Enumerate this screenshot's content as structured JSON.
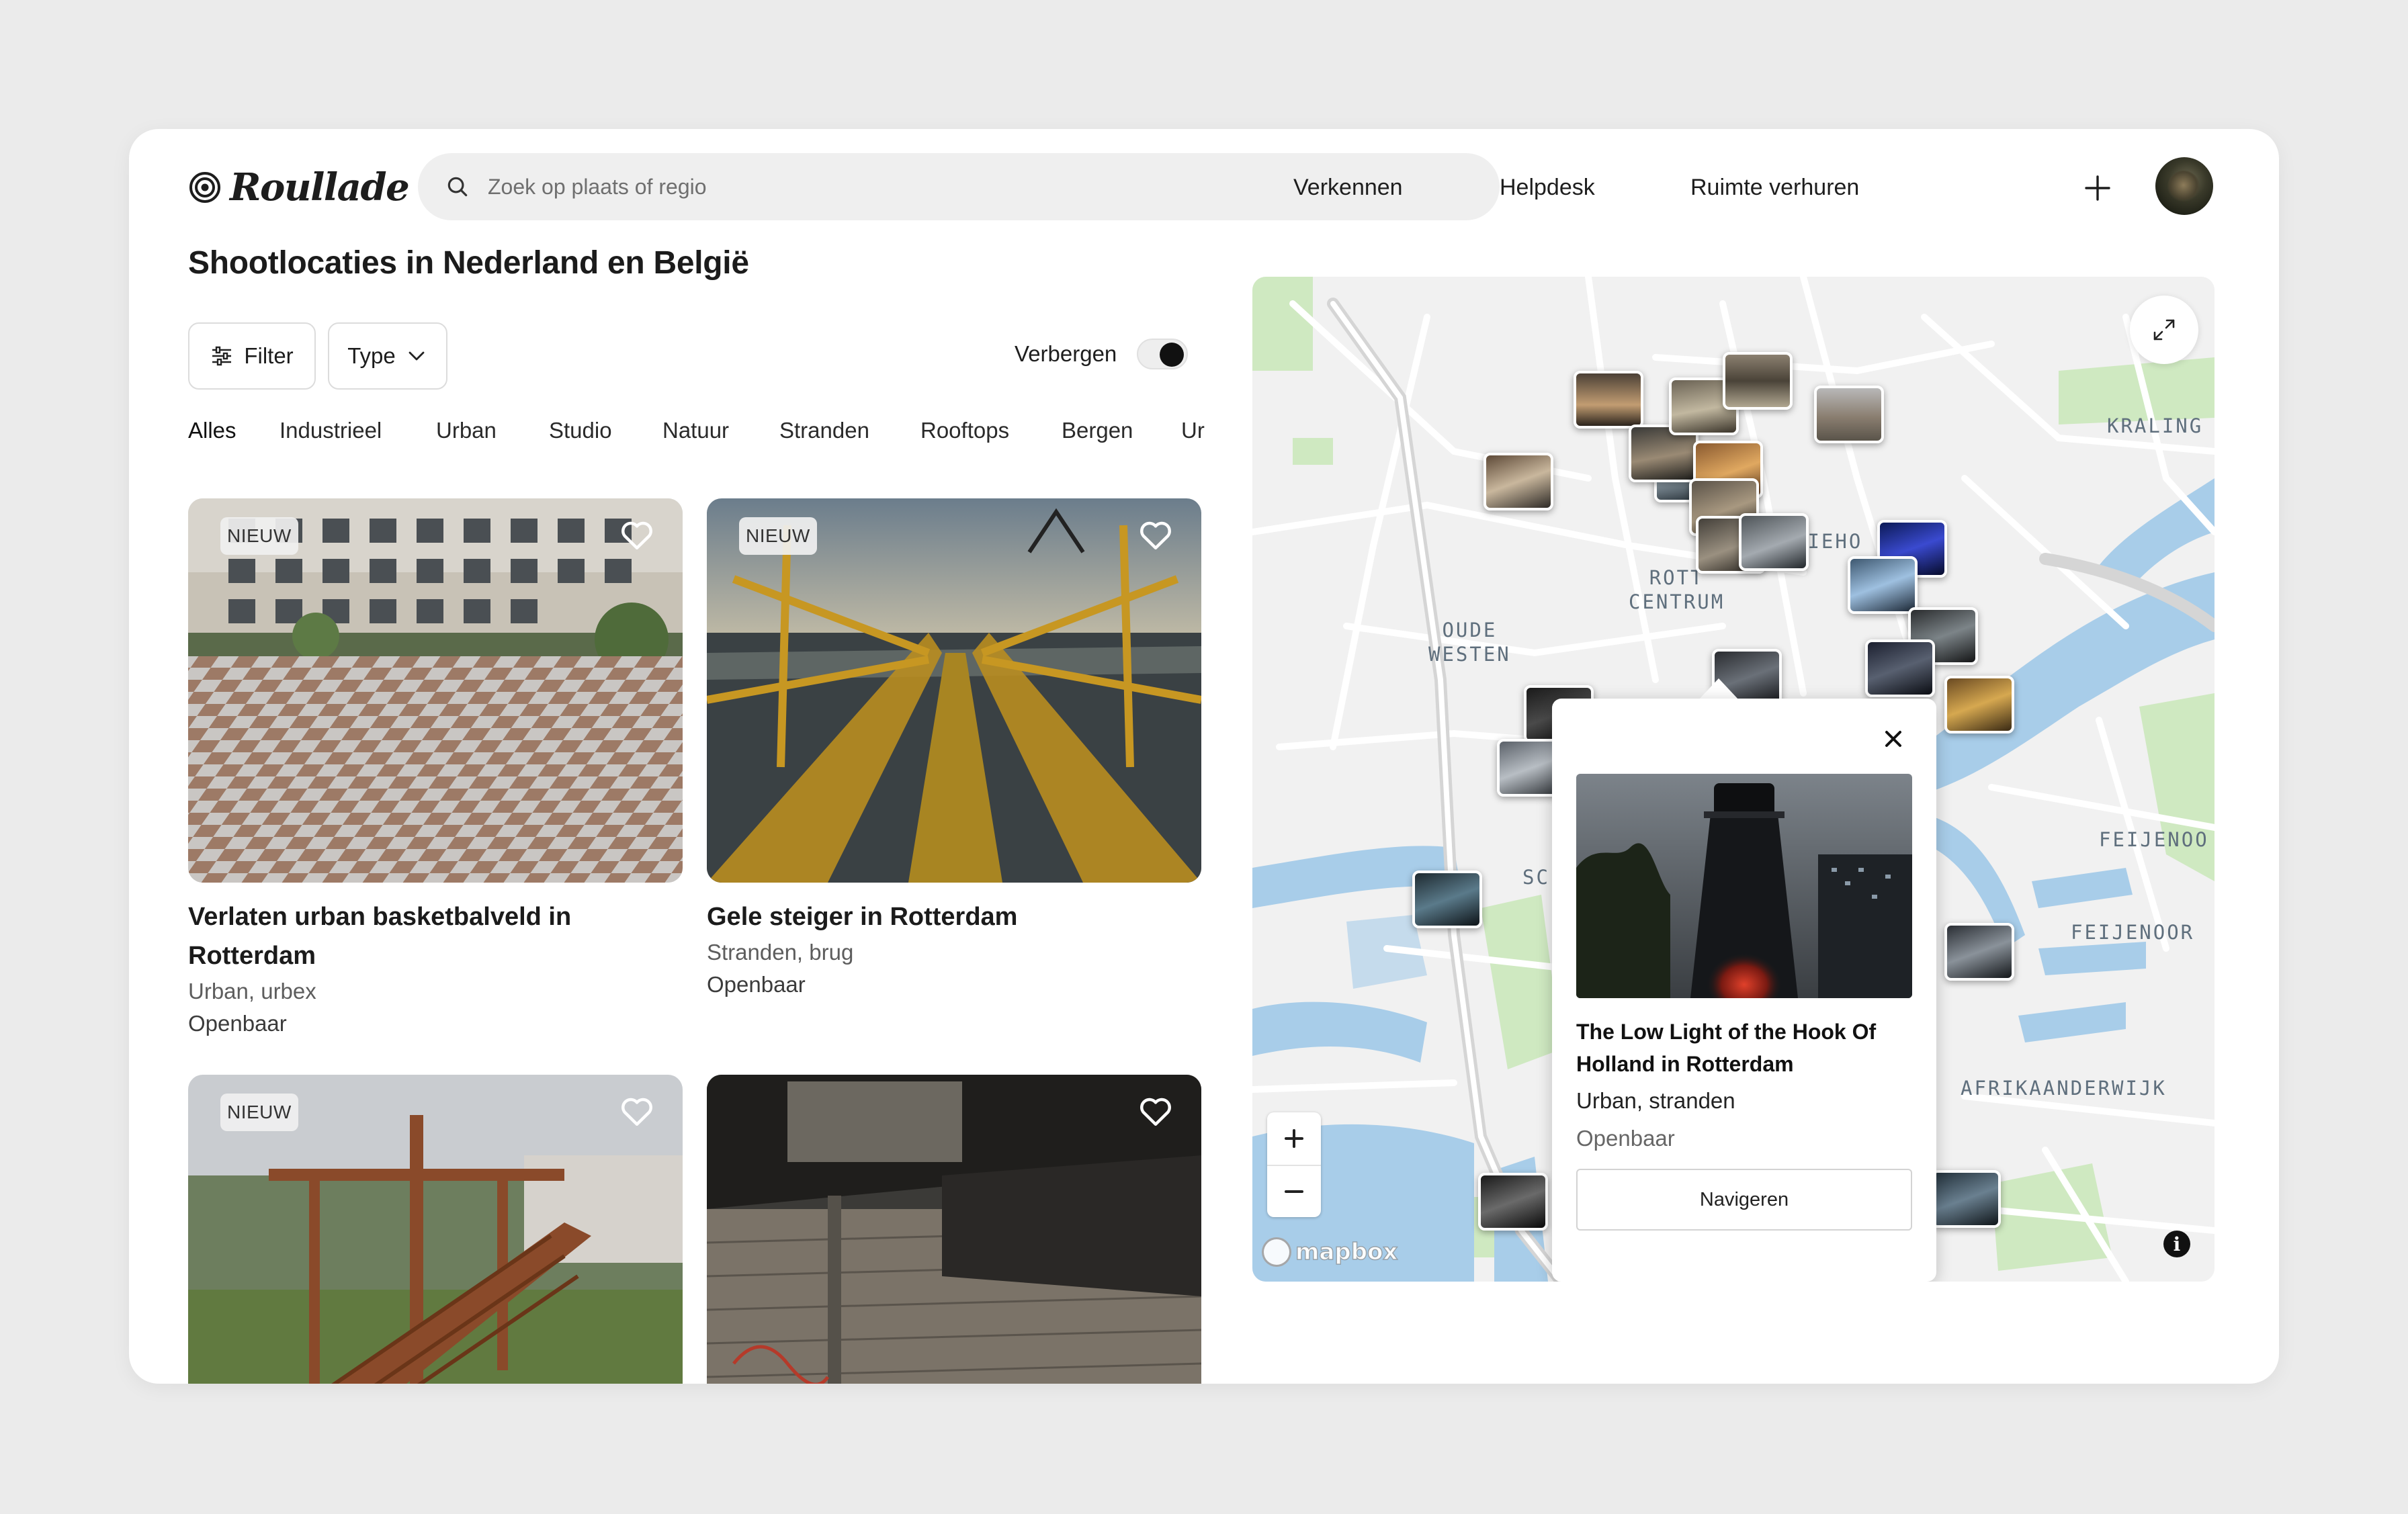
{
  "header": {
    "logo_text": "Roullade",
    "search_placeholder": "Zoek op plaats of regio",
    "nav": [
      "Verkennen",
      "Helpdesk",
      "Ruimte verhuren"
    ]
  },
  "page": {
    "title": "Shootlocaties in Nederland en België",
    "filter_label": "Filter",
    "type_label": "Type",
    "toggle_label": "Verbergen",
    "toggle_on": true
  },
  "tabs": [
    "Alles",
    "Industrieel",
    "Urban",
    "Studio",
    "Natuur",
    "Stranden",
    "Rooftops",
    "Bergen",
    "Urbex"
  ],
  "active_tab": "Alles",
  "cards": [
    {
      "badge": "NIEUW",
      "title": "Verlaten urban basketbalveld in Rotterdam",
      "tags": "Urban, urbex",
      "access": "Openbaar"
    },
    {
      "badge": "NIEUW",
      "title": "Gele steiger in Rotterdam",
      "tags": "Stranden, brug",
      "access": "Openbaar"
    },
    {
      "badge": "NIEUW",
      "title": "",
      "tags": "",
      "access": ""
    },
    {
      "badge": "",
      "title": "",
      "tags": "",
      "access": ""
    }
  ],
  "map": {
    "labels": {
      "kralingen": "KRALING",
      "oude_westen": "OUDE\nWESTEN",
      "centrum": "ROTT\nCENTRUM",
      "rieho": "RIEHO",
      "feijenoord_1": "FEIJENOO",
      "feijenoord_2": "FEIJENOOR",
      "afrikaanderwijk": "AFRIKAANDERWIJK",
      "sc": "SC"
    },
    "attribution": "mapbox",
    "popup": {
      "title": "The Low Light of the Hook Of Holland in Rotterdam",
      "tags": "Urban, stranden",
      "access": "Openbaar",
      "button": "Navigeren"
    }
  },
  "colors": {
    "water": "#a4cbe8",
    "park": "#cdeac0",
    "land": "#f1f1f1",
    "accent": "#111111"
  }
}
